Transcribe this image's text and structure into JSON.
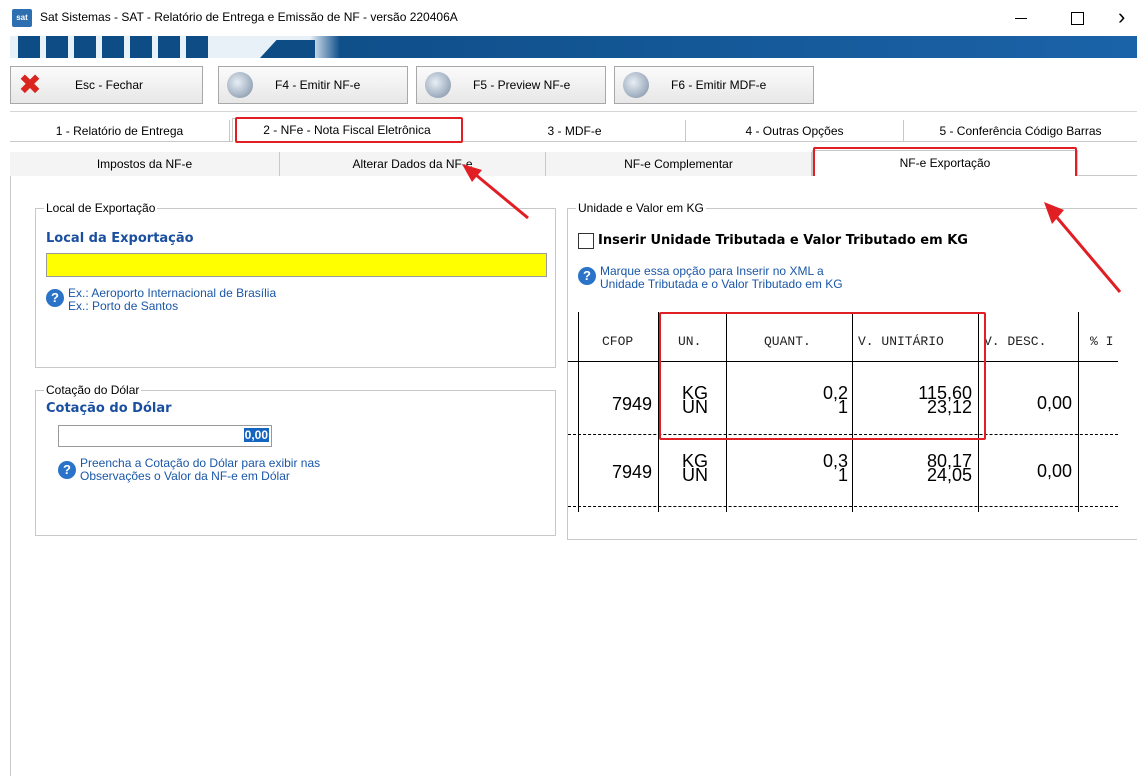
{
  "window": {
    "icon_text": "sat",
    "title": "Sat Sistemas - SAT - Relatório de Entrega e Emissão de NF - versão 220406A"
  },
  "toolbar": {
    "close_label": "Esc - Fechar",
    "f4_label": "F4 - Emitir NF-e",
    "f5_label": "F5 - Preview NF-e",
    "f6_label": "F6 - Emitir MDF-e"
  },
  "main_tabs": [
    {
      "label": "1 - Relatório de Entrega"
    },
    {
      "label": "2 - NFe - Nota Fiscal Eletrônica"
    },
    {
      "label": "3 - MDF-e"
    },
    {
      "label": "4 - Outras Opções"
    },
    {
      "label": "5 - Conferência Código Barras"
    }
  ],
  "sub_tabs": [
    {
      "label": "Impostos da NF-e"
    },
    {
      "label": "Alterar Dados da NF-e"
    },
    {
      "label": "NF-e Complementar"
    },
    {
      "label": "NF-e Exportação"
    }
  ],
  "local_exportacao": {
    "group_title": "Local de Exportação",
    "field_label": "Local da Exportação",
    "value": "",
    "help_line1": "Ex.: Aeroporto Internacional de Brasília",
    "help_line2": "Ex.: Porto de Santos"
  },
  "cotacao": {
    "group_title": "Cotação do Dólar",
    "field_label": "Cotação do Dólar",
    "value": "0,00",
    "help_line1": "Preencha a Cotação do Dólar para exibir nas",
    "help_line2": "Observações o Valor da NF-e em Dólar"
  },
  "unidade_kg": {
    "group_title": "Unidade e Valor em KG",
    "checkbox_label": "Inserir Unidade Tributada e Valor Tributado em KG",
    "checked": false,
    "help_line1": "Marque essa opção para Inserir no XML a",
    "help_line2": "Unidade Tributada e o Valor Tributado em KG"
  },
  "grid": {
    "headers": [
      "CFOP",
      "UN.",
      "QUANT.",
      "V. UNITÁRIO",
      "V. DESC.",
      "% I"
    ],
    "rows": [
      {
        "cfop": "7949",
        "un1": "KG",
        "un2": "UN",
        "q1": "0,2",
        "q2": "1",
        "v1": "115,60",
        "v2": "23,12",
        "desc": "0,00"
      },
      {
        "cfop": "7949",
        "un1": "KG",
        "un2": "UN",
        "q1": "0,3",
        "q2": "1",
        "v1": "80,17",
        "v2": "24,05",
        "desc": "0,00"
      }
    ]
  },
  "colors": {
    "highlight": "#e01e24",
    "label_blue": "#1a4fa0",
    "input_yellow": "#ffff00"
  }
}
